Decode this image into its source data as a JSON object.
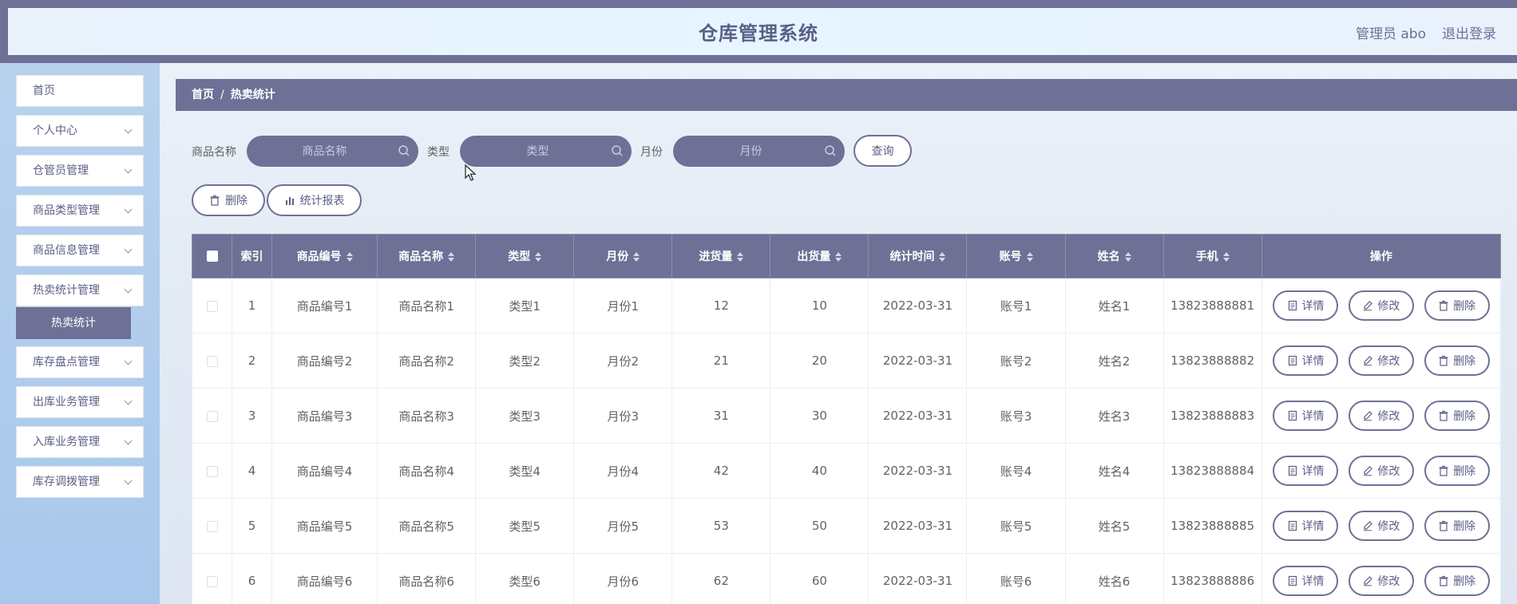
{
  "header": {
    "title": "仓库管理系统",
    "user": "管理员 abo",
    "logout": "退出登录"
  },
  "sidebar": {
    "items": [
      {
        "label": "首页",
        "expandable": false
      },
      {
        "label": "个人中心",
        "expandable": true
      },
      {
        "label": "仓管员管理",
        "expandable": true
      },
      {
        "label": "商品类型管理",
        "expandable": true
      },
      {
        "label": "商品信息管理",
        "expandable": true
      },
      {
        "label": "热卖统计管理",
        "expandable": true
      },
      {
        "label": "库存盘点管理",
        "expandable": true
      },
      {
        "label": "出库业务管理",
        "expandable": true
      },
      {
        "label": "入库业务管理",
        "expandable": true
      },
      {
        "label": "库存调拨管理",
        "expandable": true
      }
    ],
    "active_sub": "热卖统计"
  },
  "breadcrumb": {
    "home": "首页",
    "separator": "/",
    "current": "热卖统计"
  },
  "search": {
    "name_label": "商品名称",
    "name_placeholder": "商品名称",
    "type_label": "类型",
    "type_placeholder": "类型",
    "month_label": "月份",
    "month_placeholder": "月份",
    "query_button": "查询"
  },
  "toolbar": {
    "delete_label": "删除",
    "report_label": "统计报表"
  },
  "table": {
    "headers": [
      "索引",
      "商品编号",
      "商品名称",
      "类型",
      "月份",
      "进货量",
      "出货量",
      "统计时间",
      "账号",
      "姓名",
      "手机",
      "操作"
    ],
    "rows": [
      {
        "index": "1",
        "code": "商品编号1",
        "name": "商品名称1",
        "type": "类型1",
        "month": "月份1",
        "in": "12",
        "out": "10",
        "time": "2022-03-31",
        "account": "账号1",
        "person": "姓名1",
        "phone": "13823888881"
      },
      {
        "index": "2",
        "code": "商品编号2",
        "name": "商品名称2",
        "type": "类型2",
        "month": "月份2",
        "in": "21",
        "out": "20",
        "time": "2022-03-31",
        "account": "账号2",
        "person": "姓名2",
        "phone": "13823888882"
      },
      {
        "index": "3",
        "code": "商品编号3",
        "name": "商品名称3",
        "type": "类型3",
        "month": "月份3",
        "in": "31",
        "out": "30",
        "time": "2022-03-31",
        "account": "账号3",
        "person": "姓名3",
        "phone": "13823888883"
      },
      {
        "index": "4",
        "code": "商品编号4",
        "name": "商品名称4",
        "type": "类型4",
        "month": "月份4",
        "in": "42",
        "out": "40",
        "time": "2022-03-31",
        "account": "账号4",
        "person": "姓名4",
        "phone": "13823888884"
      },
      {
        "index": "5",
        "code": "商品编号5",
        "name": "商品名称5",
        "type": "类型5",
        "month": "月份5",
        "in": "53",
        "out": "50",
        "time": "2022-03-31",
        "account": "账号5",
        "person": "姓名5",
        "phone": "13823888885"
      },
      {
        "index": "6",
        "code": "商品编号6",
        "name": "商品名称6",
        "type": "类型6",
        "month": "月份6",
        "in": "62",
        "out": "60",
        "time": "2022-03-31",
        "account": "账号6",
        "person": "姓名6",
        "phone": "13823888886"
      }
    ],
    "actions": {
      "detail": "详情",
      "edit": "修改",
      "delete": "删除"
    }
  },
  "colors": {
    "primary": "#6e7096",
    "sidebar": "#a8c8ec",
    "header_bg": "#e6f5ff"
  }
}
